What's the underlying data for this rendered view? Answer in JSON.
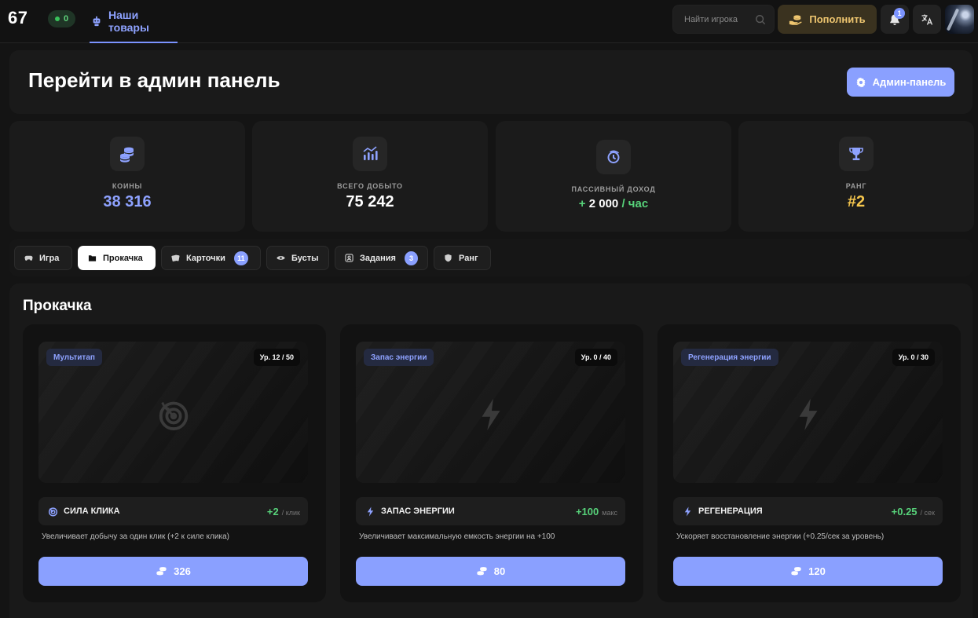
{
  "header": {
    "logo": "67",
    "online_count": "0",
    "nav_tab": "Наши товары",
    "search_placeholder": "Найти игрока",
    "topup_label": "Пополнить",
    "notifications_count": "1"
  },
  "admin": {
    "title": "Перейти в админ панель",
    "button_label": "Админ-панель"
  },
  "stats": {
    "coins": {
      "label": "КОИНЫ",
      "value": "38 316"
    },
    "total": {
      "label": "ВСЕГО ДОБЫТО",
      "value": "75 242"
    },
    "passive": {
      "label": "ПАССИВНЫЙ ДОХОД",
      "prefix": "+",
      "value": "2 000",
      "suffix": "/ час"
    },
    "rank": {
      "label": "РАНГ",
      "value": "#2"
    }
  },
  "tabs": [
    {
      "label": "Игра",
      "icon": "gamepad-icon"
    },
    {
      "label": "Прокачка",
      "icon": "folder-icon",
      "active": true
    },
    {
      "label": "Карточки",
      "icon": "cards-icon",
      "count": "11"
    },
    {
      "label": "Бусты",
      "icon": "rocket-icon"
    },
    {
      "label": "Задания",
      "icon": "tasks-icon",
      "count": "3"
    },
    {
      "label": "Ранг",
      "icon": "shield-icon"
    }
  ],
  "section": {
    "title": "Прокачка",
    "cards": [
      {
        "tag": "Мультитап",
        "level": "Ур. 12 / 50",
        "icon": "target-icon",
        "stat_name": "СИЛА КЛИКА",
        "stat_value": "+2",
        "stat_unit": "/ клик",
        "description": "Увеличивает добычу за один клик (+2 к силе клика)",
        "price": "326"
      },
      {
        "tag": "Запас энергии",
        "level": "Ур. 0 / 40",
        "icon": "lightning-icon",
        "stat_name": "ЗАПАС ЭНЕРГИИ",
        "stat_value": "+100",
        "stat_unit": "макс",
        "description": "Увеличивает максимальную емкость энергии на +100",
        "price": "80"
      },
      {
        "tag": "Регенерация энергии",
        "level": "Ур. 0 / 30",
        "icon": "lightning-icon",
        "stat_name": "РЕГЕНЕРАЦИЯ",
        "stat_value": "+0.25",
        "stat_unit": "/ сек",
        "description": "Ускоряет восстановление энергии (+0.25/сек за уровень)",
        "price": "120"
      }
    ]
  },
  "colors": {
    "accent": "#8aa0ff",
    "positive": "#57d27a",
    "gold": "#f5c64d",
    "background": "#141414"
  }
}
